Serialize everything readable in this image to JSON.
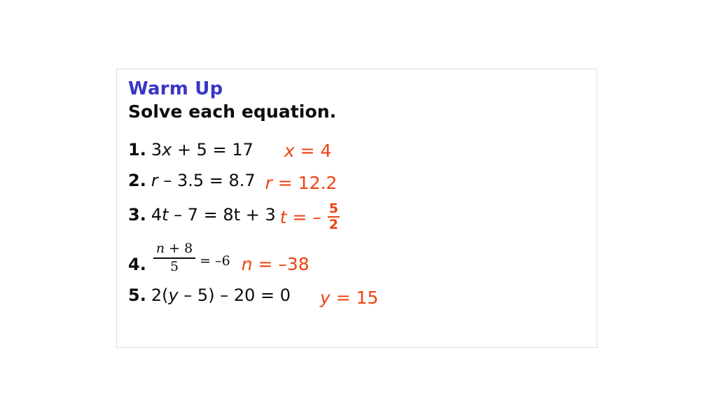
{
  "slide": {
    "title": "Warm Up",
    "subtitle": "Solve each equation.",
    "title_color": "#3A36C8",
    "text_color": "#0D0D0D",
    "answer_color": "#EE4211",
    "border_color": "#E0E0E0",
    "background_color": "#FFFFFF"
  },
  "problems": [
    {
      "number": "1.",
      "equation_prefix": "3",
      "equation_var": "x",
      "equation_suffix": " + 5 = 17",
      "equation_plain": "3x + 5 = 17",
      "answer_var": "x",
      "answer_suffix": " = 4",
      "answer_plain": "x = 4",
      "answer_type": "inline"
    },
    {
      "number": "2.",
      "equation_prefix": "",
      "equation_var": "r",
      "equation_suffix": " – 3.5 = 8.7",
      "equation_plain": "r – 3.5 = 8.7",
      "answer_var": "r",
      "answer_suffix": " = 12.2",
      "answer_plain": "r = 12.2",
      "answer_type": "inline"
    },
    {
      "number": "3.",
      "equation_prefix": "4",
      "equation_var": "t",
      "equation_suffix": " – 7 = 8t + 3",
      "equation_plain": "4t – 7 = 8t + 3",
      "answer_var": "t",
      "answer_suffix": " = – ",
      "answer_plain": "t = – 5/2",
      "answer_type": "fraction",
      "answer_numerator": "5",
      "answer_denominator": "2"
    },
    {
      "number": "4.",
      "equation_type": "fraction",
      "equation_numerator_var": "n",
      "equation_numerator_rest": " + 8",
      "equation_denominator": "5",
      "equation_rest": "= –6",
      "equation_plain": "(n + 8)/5 = –6",
      "answer_var": "n",
      "answer_suffix": " = –38",
      "answer_plain": "n = –38",
      "answer_type": "inline"
    },
    {
      "number": "5.",
      "equation_prefix": "2(",
      "equation_var": "y",
      "equation_suffix": " – 5) – 20 = 0",
      "equation_plain": "2(y – 5) – 20 = 0",
      "answer_var": "y",
      "answer_suffix": " = 15",
      "answer_plain": "y = 15",
      "answer_type": "inline"
    }
  ]
}
